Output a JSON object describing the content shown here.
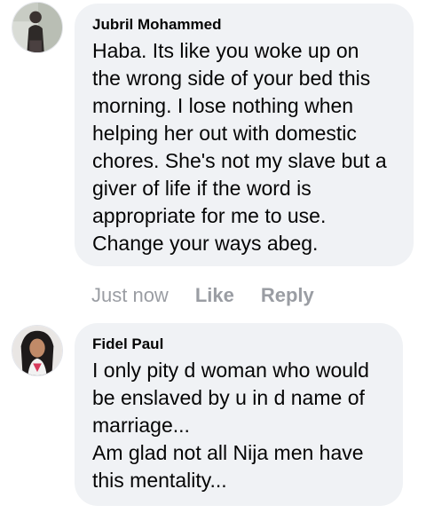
{
  "comments": [
    {
      "author": "Jubril Mohammed",
      "avatar_icon": "user-photo-icon",
      "lines": [
        "Haba. Its like you woke up on",
        "the wrong side of your bed this",
        "morning. I lose nothing when",
        "helping her out with domestic",
        "chores. She's not my slave but a",
        "giver of life if the word is",
        "appropriate for me to use.",
        "Change your ways abeg."
      ],
      "time": "Just now",
      "like_label": "Like",
      "reply_label": "Reply"
    },
    {
      "author": "Fidel Paul",
      "avatar_icon": "user-photo-icon",
      "lines": [
        "I only pity d woman who would",
        "be enslaved by u in d name of",
        "marriage...",
        "Am glad not all Nija men have",
        "this mentality..."
      ]
    }
  ],
  "colors": {
    "bubble_bg": "#f0f2f5",
    "text": "#050505",
    "meta": "#9a9da3"
  }
}
